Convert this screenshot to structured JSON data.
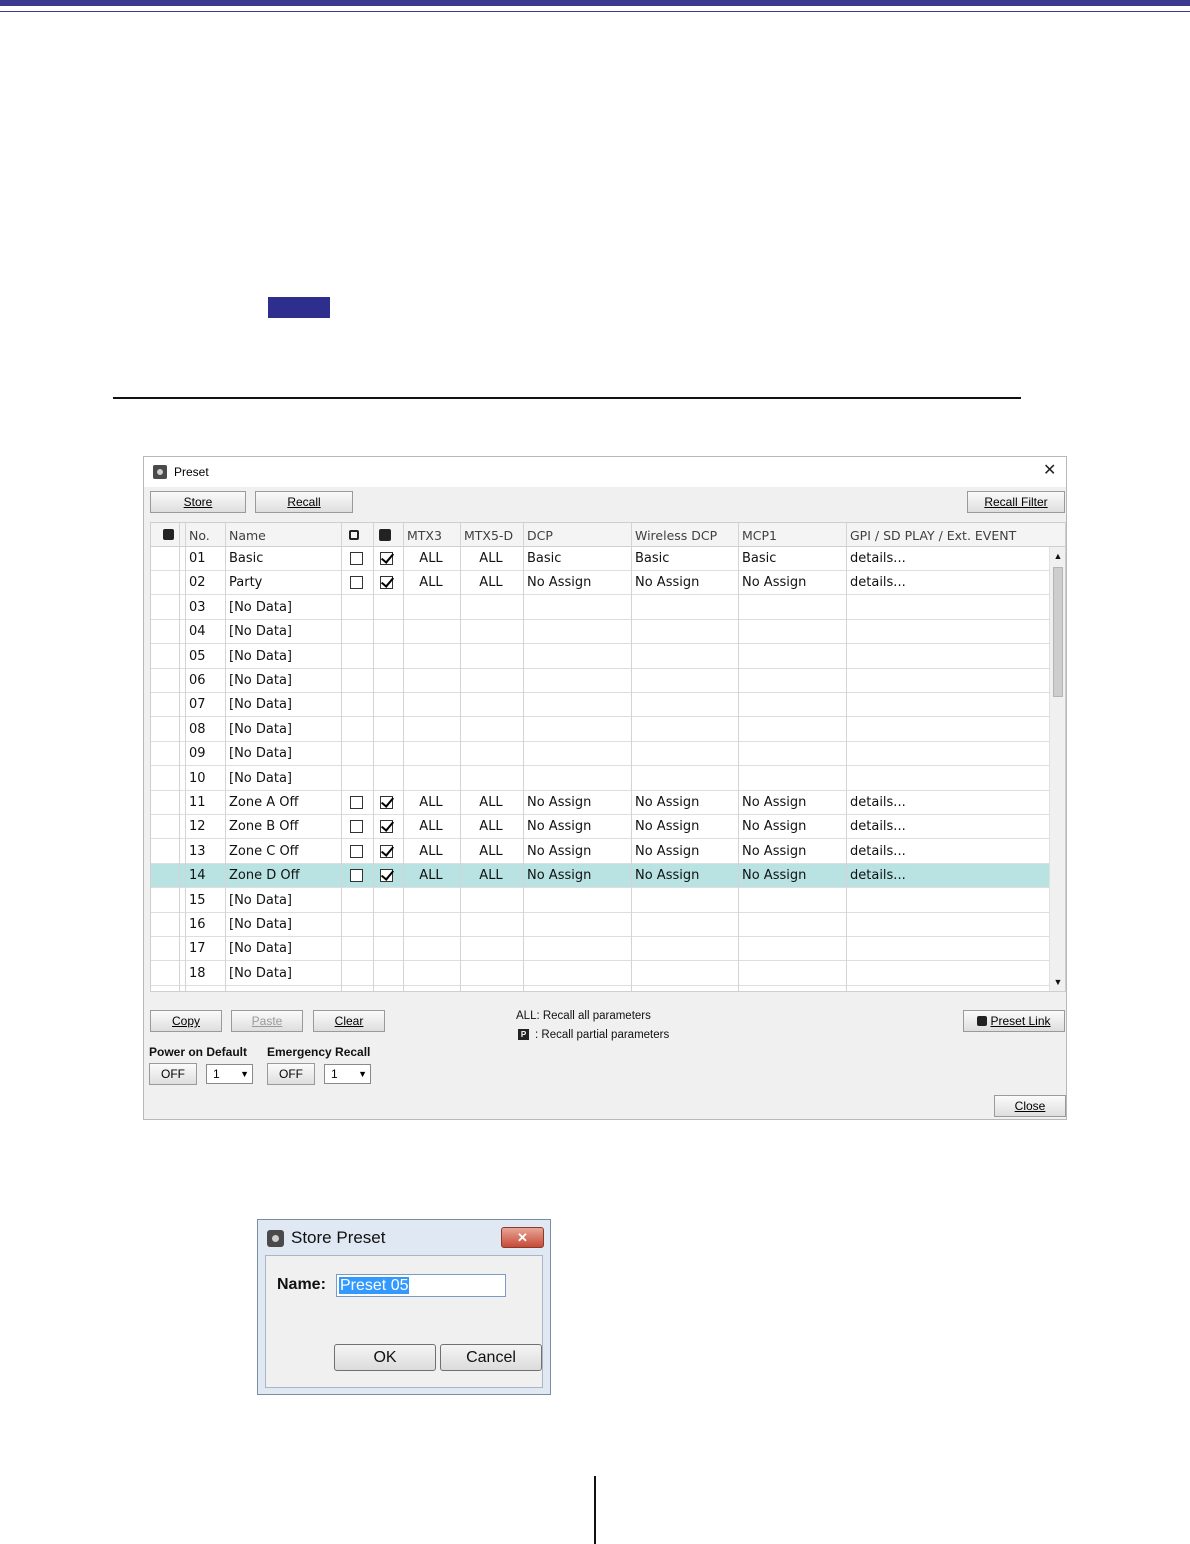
{
  "preset_window": {
    "title": "Preset",
    "buttons": {
      "store": "Store",
      "recall": "Recall",
      "recall_filter": "Recall Filter",
      "copy": "Copy",
      "paste": "Paste",
      "clear": "Clear",
      "preset_link": "Preset Link",
      "close": "Close"
    },
    "columns": [
      "",
      "No.",
      "Name",
      "",
      "",
      "MTX3",
      "MTX5-D",
      "DCP",
      "Wireless DCP",
      "MCP1",
      "GPI / SD PLAY / Ext. EVENT"
    ],
    "rows": [
      {
        "no": "01",
        "name": "Basic",
        "lock": false,
        "recall": true,
        "mtx3": "ALL",
        "mtx5d": "ALL",
        "dcp": "Basic",
        "wdcp": "Basic",
        "mcp1": "Basic",
        "gpi": "details...",
        "has_data": true
      },
      {
        "no": "02",
        "name": "Party",
        "lock": false,
        "recall": true,
        "mtx3": "ALL",
        "mtx5d": "ALL",
        "dcp": "No Assign",
        "wdcp": "No Assign",
        "mcp1": "No Assign",
        "gpi": "details...",
        "has_data": true
      },
      {
        "no": "03",
        "name": "[No Data]",
        "has_data": false
      },
      {
        "no": "04",
        "name": "[No Data]",
        "has_data": false
      },
      {
        "no": "05",
        "name": "[No Data]",
        "has_data": false
      },
      {
        "no": "06",
        "name": "[No Data]",
        "has_data": false
      },
      {
        "no": "07",
        "name": "[No Data]",
        "has_data": false
      },
      {
        "no": "08",
        "name": "[No Data]",
        "has_data": false
      },
      {
        "no": "09",
        "name": "[No Data]",
        "has_data": false
      },
      {
        "no": "10",
        "name": "[No Data]",
        "has_data": false
      },
      {
        "no": "11",
        "name": "Zone A Off",
        "lock": false,
        "recall": true,
        "mtx3": "ALL",
        "mtx5d": "ALL",
        "dcp": "No Assign",
        "wdcp": "No Assign",
        "mcp1": "No Assign",
        "gpi": "details...",
        "has_data": true
      },
      {
        "no": "12",
        "name": "Zone B Off",
        "lock": false,
        "recall": true,
        "mtx3": "ALL",
        "mtx5d": "ALL",
        "dcp": "No Assign",
        "wdcp": "No Assign",
        "mcp1": "No Assign",
        "gpi": "details...",
        "has_data": true
      },
      {
        "no": "13",
        "name": "Zone C Off",
        "lock": false,
        "recall": true,
        "mtx3": "ALL",
        "mtx5d": "ALL",
        "dcp": "No Assign",
        "wdcp": "No Assign",
        "mcp1": "No Assign",
        "gpi": "details...",
        "has_data": true
      },
      {
        "no": "14",
        "name": "Zone D Off",
        "lock": false,
        "recall": true,
        "mtx3": "ALL",
        "mtx5d": "ALL",
        "dcp": "No Assign",
        "wdcp": "No Assign",
        "mcp1": "No Assign",
        "gpi": "details...",
        "has_data": true,
        "selected": true
      },
      {
        "no": "15",
        "name": "[No Data]",
        "has_data": false
      },
      {
        "no": "16",
        "name": "[No Data]",
        "has_data": false
      },
      {
        "no": "17",
        "name": "[No Data]",
        "has_data": false
      },
      {
        "no": "18",
        "name": "[No Data]",
        "has_data": false
      }
    ],
    "legend": {
      "all": "ALL: Recall all parameters",
      "partial_badge": "P",
      "partial": ": Recall partial parameters"
    },
    "power_on_default": {
      "label": "Power on Default",
      "toggle": "OFF",
      "value": "1"
    },
    "emergency_recall": {
      "label": "Emergency Recall",
      "toggle": "OFF",
      "value": "1"
    },
    "selected_row_color": "#b9e3e3"
  },
  "store_dialog": {
    "title": "Store Preset",
    "name_label": "Name:",
    "name_value": "Preset 05",
    "ok": "OK",
    "cancel": "Cancel"
  }
}
